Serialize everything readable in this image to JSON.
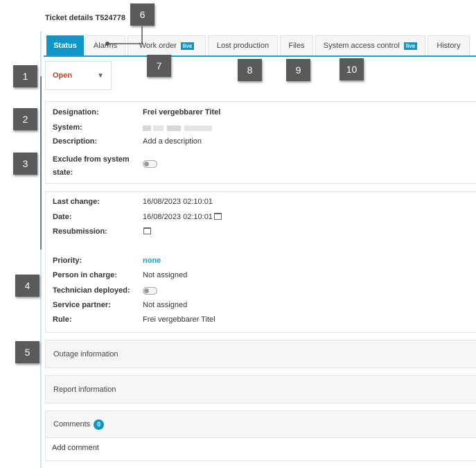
{
  "header": {
    "title": "Ticket details T524778"
  },
  "tabs": [
    {
      "label": "Status",
      "active": true
    },
    {
      "label": "Alarms"
    },
    {
      "label": "Work order",
      "badge": "live"
    },
    {
      "label": "Lost production"
    },
    {
      "label": "Files"
    },
    {
      "label": "System access control",
      "badge": "live"
    },
    {
      "label": "History"
    }
  ],
  "status_dropdown": {
    "value": "Open",
    "icon": "triangle-down-icon"
  },
  "general": {
    "designation_label": "Designation:",
    "designation": "Frei vergebbarer Titel",
    "system_label": "System:",
    "description_label": "Description:",
    "description": "Add a description",
    "exclude_label_1": "Exclude from system",
    "exclude_label_2": "state:",
    "exclude_on": false
  },
  "details": {
    "last_change_label": "Last change:",
    "last_change": "16/08/2023 02:10:01",
    "date_label": "Date:",
    "date": "16/08/2023 02:10:01",
    "resubmission_label": "Resubmission:",
    "priority_label": "Priority:",
    "priority": "none",
    "person_label": "Person in charge:",
    "person": "Not assigned",
    "technician_label": "Technician deployed:",
    "technician_on": false,
    "partner_label": "Service partner:",
    "partner": "Not assigned",
    "rule_label": "Rule:",
    "rule": "Frei vergebbarer Titel"
  },
  "sections": {
    "outage": "Outage information",
    "report": "Report information",
    "comments": "Comments",
    "comments_count": "0",
    "add_comment": "Add comment"
  },
  "callouts": [
    "1",
    "2",
    "3",
    "4",
    "5",
    "6",
    "7",
    "8",
    "9",
    "10"
  ],
  "colors": {
    "accent": "#0e96c9",
    "status_open": "#c9411f",
    "callout": "#5a5a5a"
  }
}
